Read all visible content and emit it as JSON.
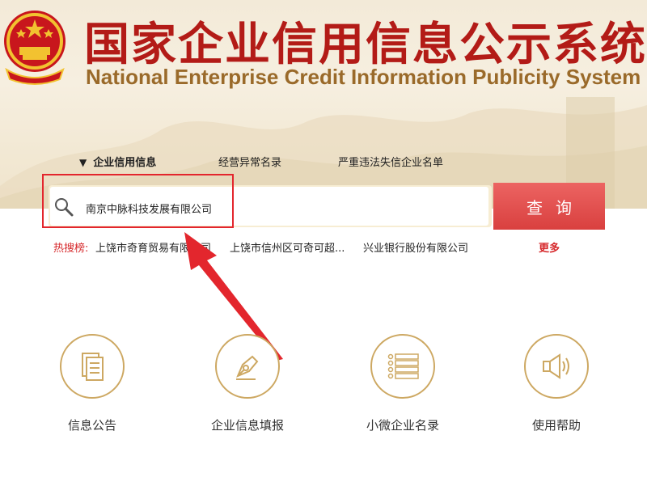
{
  "header": {
    "title_cn": "国家企业信用信息公示系统",
    "title_en": "National Enterprise Credit Information Publicity System"
  },
  "tabs": [
    {
      "label": "企业信用信息",
      "active": true
    },
    {
      "label": "经营异常名录",
      "active": false
    },
    {
      "label": "严重违法失信企业名单",
      "active": false
    }
  ],
  "search": {
    "value": "南京中脉科技发展有限公司",
    "button_label": "查询"
  },
  "hot": {
    "label": "热搜榜:",
    "items": [
      "上饶市奇育贸易有限公司",
      "上饶市信州区可奇可超...",
      "兴业银行股份有限公司"
    ],
    "more_label": "更多"
  },
  "features": [
    {
      "label": "信息公告",
      "icon": "document-icon"
    },
    {
      "label": "企业信息填报",
      "icon": "pen-icon"
    },
    {
      "label": "小微企业名录",
      "icon": "list-icon"
    },
    {
      "label": "使用帮助",
      "icon": "speaker-icon"
    }
  ],
  "colors": {
    "brand_red": "#b31b17",
    "button_red": "#e05250",
    "gold": "#cda862",
    "annotation_red": "#e3262d"
  }
}
